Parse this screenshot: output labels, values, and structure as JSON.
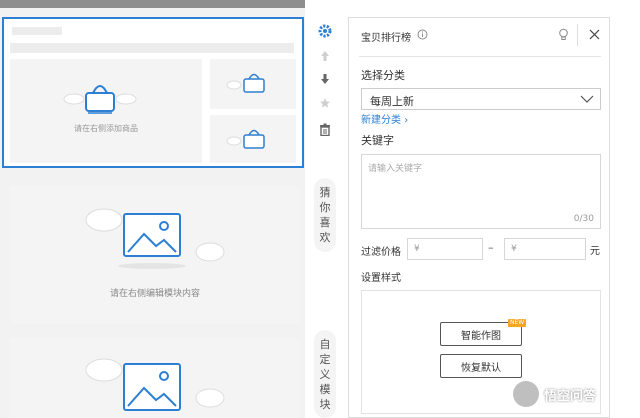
{
  "canvas": {
    "module1": {
      "add_product_hint": "请在右侧添加商品"
    },
    "module2": {
      "edit_hint": "请在右侧编辑模块内容"
    }
  },
  "side_tabs": {
    "guess": "猜你喜欢",
    "custom": "自定义模块"
  },
  "panel": {
    "title": "宝贝排行榜",
    "category_label": "选择分类",
    "category_value": "每周上新",
    "new_category_link": "新建分类",
    "keyword_label": "关键字",
    "keyword_placeholder": "请输入关键字",
    "keyword_count": "0/30",
    "price_label": "过滤价格",
    "price_min_prefix": "¥",
    "price_max_prefix": "¥",
    "price_dash": "–",
    "price_unit": "元",
    "style_label": "设置样式",
    "smart_button": "智能作图",
    "new_badge": "NEW",
    "reset_button": "恢复默认"
  },
  "watermark": {
    "text": "悟空问答"
  },
  "colors": {
    "accent": "#2d7fd3",
    "badge": "#f5a623"
  }
}
